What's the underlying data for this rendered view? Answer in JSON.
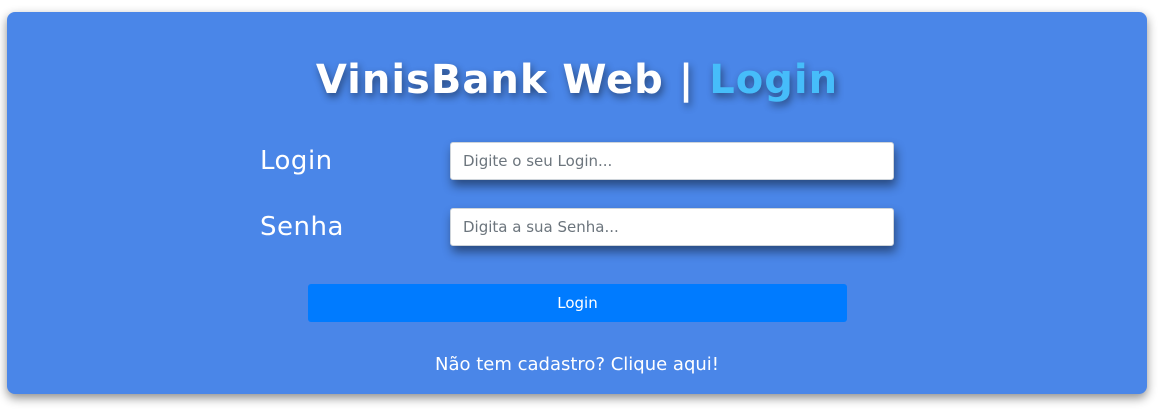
{
  "header": {
    "title_main": "VinisBank Web | ",
    "title_accent": "Login"
  },
  "form": {
    "login_label": "Login",
    "login_placeholder": "Digite o seu Login...",
    "password_label": "Senha",
    "password_placeholder": "Digita a sua Senha...",
    "submit_label": "Login"
  },
  "footer": {
    "register_link": "Não tem cadastro? Clique aqui!"
  },
  "colors": {
    "card_background": "#4a86e8",
    "title_accent": "#46bdfa",
    "button_primary": "#007bff"
  }
}
